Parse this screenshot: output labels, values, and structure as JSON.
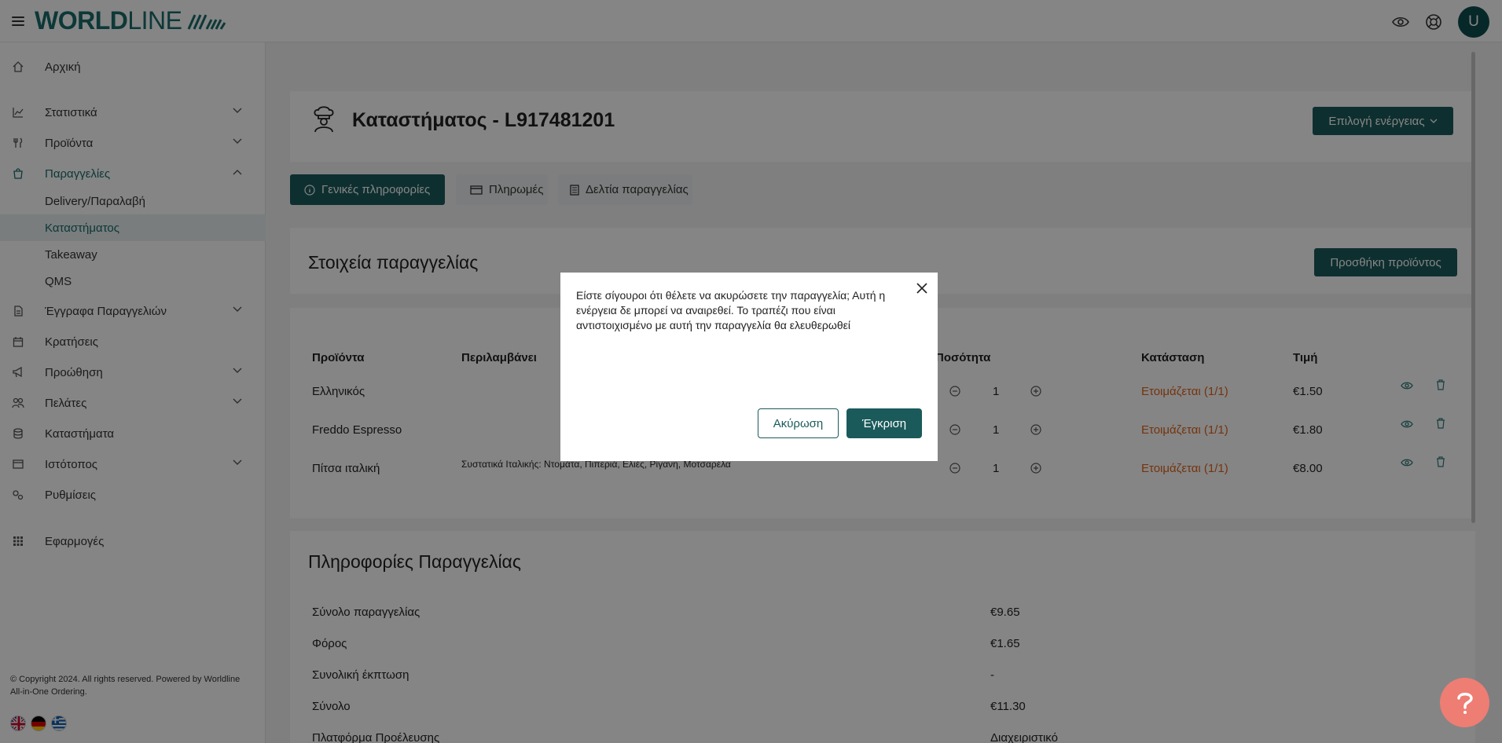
{
  "header": {
    "logo_bold": "WORLD",
    "logo_light": "LINE",
    "avatar_initial": "U"
  },
  "sidebar": {
    "items": [
      {
        "label": "Αρχική"
      },
      {
        "label": "Στατιστικά"
      },
      {
        "label": "Προϊόντα"
      },
      {
        "label": "Παραγγελίες"
      },
      {
        "label": "Έγγραφα Παραγγελιών"
      },
      {
        "label": "Κρατήσεις"
      },
      {
        "label": "Προώθηση"
      },
      {
        "label": "Πελάτες"
      },
      {
        "label": "Καταστήματα"
      },
      {
        "label": "Ιστότοπος"
      },
      {
        "label": "Ρυθμίσεις"
      },
      {
        "label": "Εφαρμογές"
      }
    ],
    "subitems": [
      {
        "label": "Delivery/Παραλαβή"
      },
      {
        "label": "Καταστήματος"
      },
      {
        "label": "Takeaway"
      },
      {
        "label": "QMS"
      }
    ],
    "copyright": "© Copyright 2024. All rights reserved. Powered by Worldline All-in-One Ordering."
  },
  "page": {
    "title": "Καταστήματος - L917481201",
    "action_button": "Επιλογή ενέργειας",
    "tabs": [
      {
        "label": "Γενικές πληροφορίες"
      },
      {
        "label": "Πληρωμές"
      },
      {
        "label": "Δελτία παραγγελίας"
      }
    ]
  },
  "order_details": {
    "title": "Στοιχεία παραγγελίας",
    "add_product_button": "Προσθήκη προϊόντος",
    "columns": {
      "product": "Προϊόντα",
      "includes": "Περιλαμβάνει",
      "quantity": "Ποσότητα",
      "status": "Κατάσταση",
      "price": "Τιμή"
    },
    "rows": [
      {
        "product": "Ελληνικός",
        "includes": "",
        "qty": "1",
        "status": "Ετοιμάζεται (1/1)",
        "price": "€1.50"
      },
      {
        "product": "Freddo Espresso",
        "includes": "",
        "qty": "1",
        "status": "Ετοιμάζεται (1/1)",
        "price": "€1.80"
      },
      {
        "product": "Πίτσα ιταλική",
        "includes": "Συστατικά Ιταλικής: Ντομάτα, Πιπεριά, Ελιές, Ρίγανη, Μοτσαρέλα",
        "qty": "1",
        "status": "Ετοιμάζεται (1/1)",
        "price": "€8.00"
      }
    ]
  },
  "order_info": {
    "title": "Πληροφορίες Παραγγελίας",
    "rows": [
      {
        "label": "Σύνολο παραγγελίας",
        "value": "€9.65"
      },
      {
        "label": "Φόρος",
        "value": "€1.65"
      },
      {
        "label": "Συνολική έκπτωση",
        "value": "-"
      },
      {
        "label": "Σύνολο",
        "value": "€11.30"
      },
      {
        "label": "Πλατφόρμα Προέλευσης",
        "value": "Διαχειριστικό"
      }
    ]
  },
  "modal": {
    "message": "Είστε σίγουροι ότι θέλετε να ακυρώσετε την παραγγελία; Αυτή η ενέργεια δε μπορεί να αναιρεθεί. Το τραπέζι που είναι αντιστοιχισμένο με αυτή την παραγγελία θα ελευθερωθεί",
    "cancel_label": "Ακύρωση",
    "confirm_label": "Έγκριση"
  },
  "colors": {
    "brand": "#1b5a5b",
    "status_orange": "#e0641c",
    "help_fab": "#ee7d73"
  }
}
